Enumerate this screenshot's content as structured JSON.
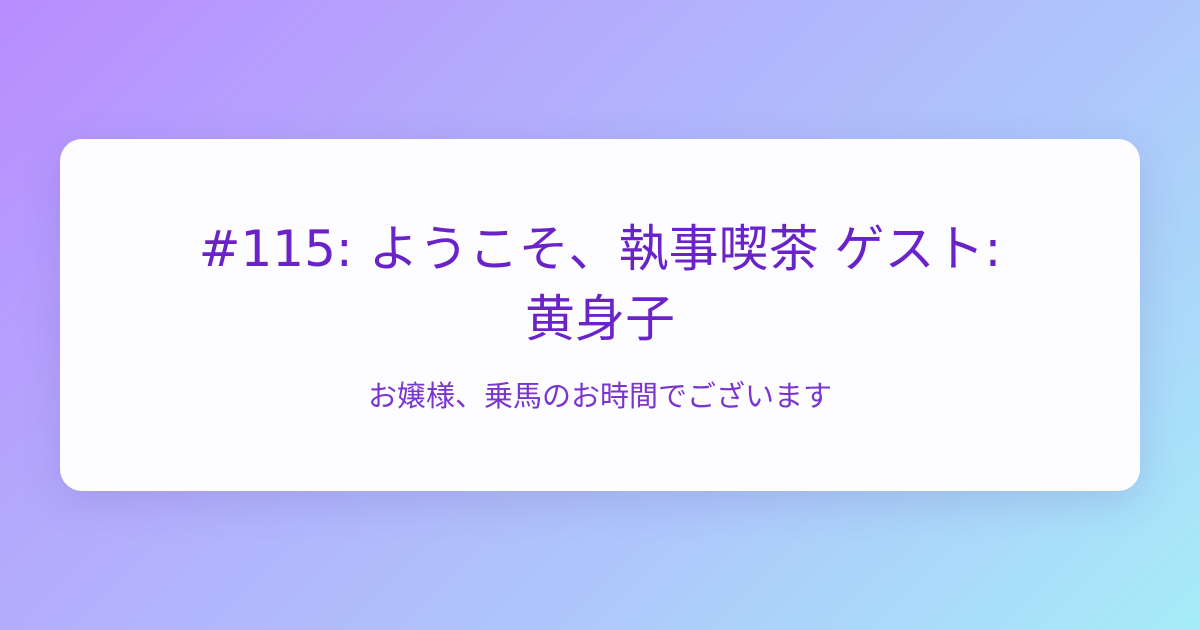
{
  "card": {
    "title": "#115: ようこそ、執事喫茶 ゲスト: 黄身子",
    "subtitle": "お嬢様、乗馬のお時間でございます"
  },
  "colors": {
    "gradient_start": "#b98cff",
    "gradient_end": "#a6ecf8",
    "card_background": "#fdfcfe",
    "text": "#6a23c9"
  }
}
